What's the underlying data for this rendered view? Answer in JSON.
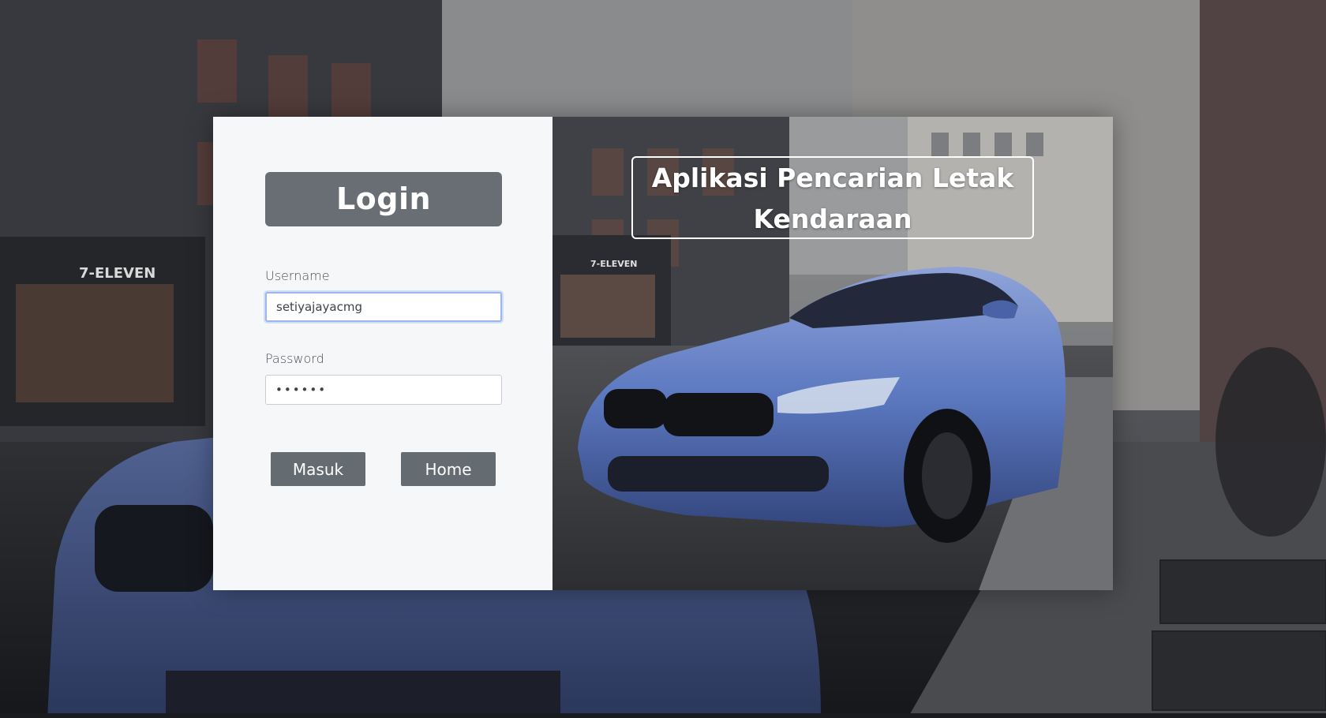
{
  "login": {
    "title": "Login",
    "username_label": "Username",
    "username_value": "setiyajayacmg",
    "password_label": "Password",
    "password_value": "••••••",
    "submit_label": "Masuk",
    "home_label": "Home"
  },
  "hero": {
    "app_title": "Aplikasi Pencarian Letak Kendaraan"
  },
  "colors": {
    "panel_bg": "#f6f7f9",
    "button_bg": "#656c71",
    "title_bg": "#686e73",
    "focus_border": "#9ab8ef",
    "car_blue": "#5b78c0"
  }
}
